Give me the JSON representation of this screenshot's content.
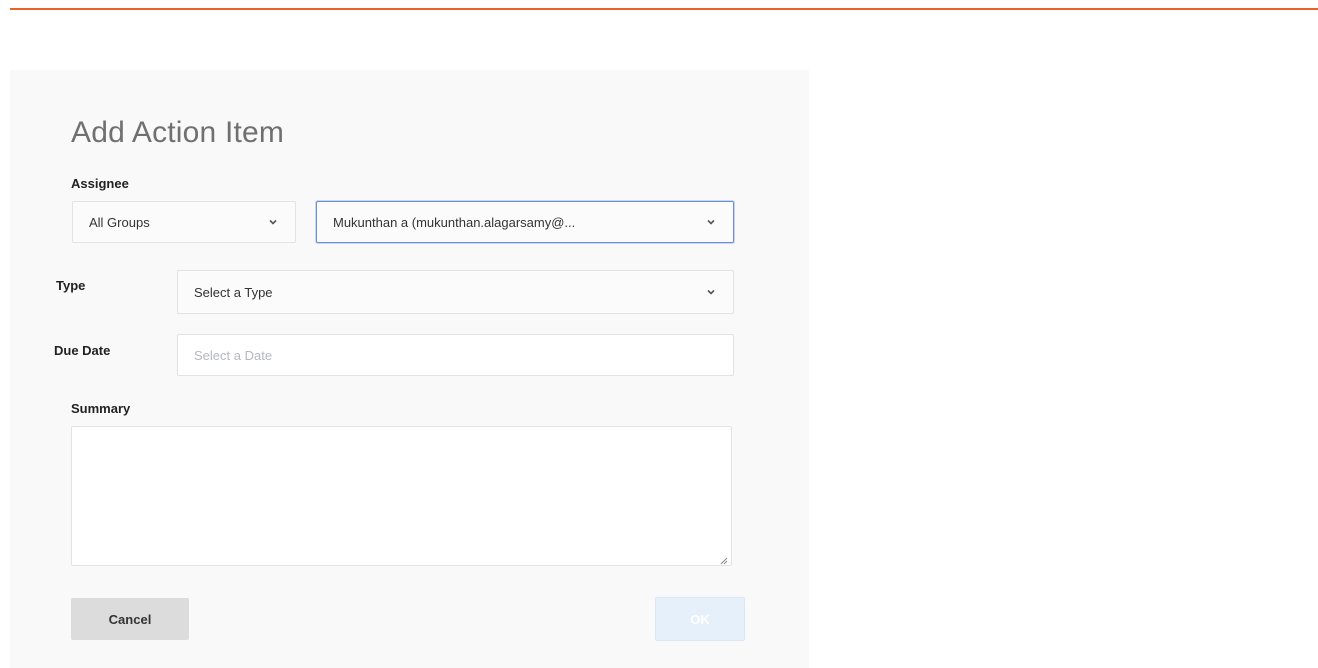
{
  "dialog": {
    "title": "Add Action Item",
    "assignee": {
      "label": "Assignee",
      "group_select": {
        "value": "All Groups"
      },
      "user_select": {
        "value": "Mukunthan a (mukunthan.alagarsamy@..."
      }
    },
    "type": {
      "label": "Type",
      "select": {
        "value": "Select a Type"
      }
    },
    "due_date": {
      "label": "Due Date",
      "input": {
        "placeholder": "Select a Date"
      }
    },
    "summary": {
      "label": "Summary",
      "value": ""
    },
    "buttons": {
      "cancel_label": "Cancel",
      "ok_label": "OK"
    }
  },
  "colors": {
    "accent_rule": "#e8602c",
    "focus_border": "#6b8fd6",
    "ok_disabled_bg": "#e6f0fa"
  },
  "icons": {
    "dropdown": "chevron-down-icon",
    "resize": "resize-handle-icon"
  }
}
